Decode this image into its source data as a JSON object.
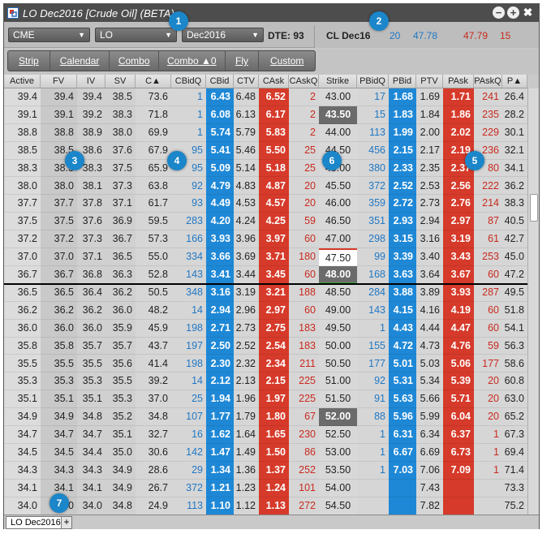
{
  "window": {
    "title": "LO Dec2016 [Crude Oil] (BETA)"
  },
  "toolbar": {
    "exchange": "CME",
    "product": "LO",
    "expiry": "Dec2016",
    "dte": "DTE: 93",
    "quote_contract": "CL Dec16",
    "quote_bidq": "20",
    "quote_bid": "47.78",
    "quote_ask": "47.79",
    "quote_askq": "15"
  },
  "buttons": [
    "Strip",
    "Calendar",
    "Combo",
    "Combo ▲0",
    "Fly",
    "Custom"
  ],
  "columns": [
    "Active",
    "FV",
    "IV",
    "SV",
    "C▲",
    "CBidQ",
    "CBid",
    "CTV",
    "CAsk",
    "CAskQ",
    "Strike",
    "PBidQ",
    "PBid",
    "PTV",
    "PAsk",
    "PAskQ",
    "P▲"
  ],
  "rows": [
    [
      "39.4",
      "39.4",
      "39.4",
      "38.5",
      "73.6",
      "1",
      "6.43",
      "6.48",
      "6.52",
      "2",
      "43.00",
      "17",
      "1.68",
      "1.69",
      "1.71",
      "241",
      "26.4"
    ],
    [
      "39.1",
      "39.1",
      "39.2",
      "38.3",
      "71.8",
      "1",
      "6.08",
      "6.13",
      "6.17",
      "2",
      "43.50",
      "15",
      "1.83",
      "1.84",
      "1.86",
      "235",
      "28.2"
    ],
    [
      "38.8",
      "38.8",
      "38.9",
      "38.0",
      "69.9",
      "1",
      "5.74",
      "5.79",
      "5.83",
      "2",
      "44.00",
      "113",
      "1.99",
      "2.00",
      "2.02",
      "229",
      "30.1"
    ],
    [
      "38.5",
      "38.5",
      "38.6",
      "37.6",
      "67.9",
      "95",
      "5.41",
      "5.46",
      "5.50",
      "25",
      "44.50",
      "456",
      "2.15",
      "2.17",
      "2.19",
      "236",
      "32.1"
    ],
    [
      "38.3",
      "38.3",
      "38.3",
      "37.5",
      "65.9",
      "95",
      "5.09",
      "5.14",
      "5.18",
      "25",
      "45.00",
      "380",
      "2.33",
      "2.35",
      "2.37",
      "80",
      "34.1"
    ],
    [
      "38.0",
      "38.0",
      "38.1",
      "37.3",
      "63.8",
      "92",
      "4.79",
      "4.83",
      "4.87",
      "20",
      "45.50",
      "372",
      "2.52",
      "2.53",
      "2.56",
      "222",
      "36.2"
    ],
    [
      "37.7",
      "37.7",
      "37.8",
      "37.1",
      "61.7",
      "93",
      "4.49",
      "4.53",
      "4.57",
      "20",
      "46.00",
      "359",
      "2.72",
      "2.73",
      "2.76",
      "214",
      "38.3"
    ],
    [
      "37.5",
      "37.5",
      "37.6",
      "36.9",
      "59.5",
      "283",
      "4.20",
      "4.24",
      "4.25",
      "59",
      "46.50",
      "351",
      "2.93",
      "2.94",
      "2.97",
      "87",
      "40.5"
    ],
    [
      "37.2",
      "37.2",
      "37.3",
      "36.7",
      "57.3",
      "166",
      "3.93",
      "3.96",
      "3.97",
      "60",
      "47.00",
      "298",
      "3.15",
      "3.16",
      "3.19",
      "61",
      "42.7"
    ],
    [
      "37.0",
      "37.0",
      "37.1",
      "36.5",
      "55.0",
      "334",
      "3.66",
      "3.69",
      "3.71",
      "180",
      "47.50",
      "99",
      "3.39",
      "3.40",
      "3.43",
      "253",
      "45.0"
    ],
    [
      "36.7",
      "36.7",
      "36.8",
      "36.3",
      "52.8",
      "143",
      "3.41",
      "3.44",
      "3.45",
      "60",
      "48.00",
      "168",
      "3.63",
      "3.64",
      "3.67",
      "60",
      "47.2"
    ],
    [
      "36.5",
      "36.5",
      "36.4",
      "36.2",
      "50.5",
      "348",
      "3.16",
      "3.19",
      "3.21",
      "188",
      "48.50",
      "284",
      "3.88",
      "3.89",
      "3.93",
      "287",
      "49.5"
    ],
    [
      "36.2",
      "36.2",
      "36.2",
      "36.0",
      "48.2",
      "14",
      "2.94",
      "2.96",
      "2.97",
      "60",
      "49.00",
      "143",
      "4.15",
      "4.16",
      "4.19",
      "60",
      "51.8"
    ],
    [
      "36.0",
      "36.0",
      "36.0",
      "35.9",
      "45.9",
      "198",
      "2.71",
      "2.73",
      "2.75",
      "183",
      "49.50",
      "1",
      "4.43",
      "4.44",
      "4.47",
      "60",
      "54.1"
    ],
    [
      "35.8",
      "35.8",
      "35.7",
      "35.7",
      "43.7",
      "197",
      "2.50",
      "2.52",
      "2.54",
      "183",
      "50.00",
      "155",
      "4.72",
      "4.73",
      "4.76",
      "59",
      "56.3"
    ],
    [
      "35.5",
      "35.5",
      "35.5",
      "35.6",
      "41.4",
      "198",
      "2.30",
      "2.32",
      "2.34",
      "211",
      "50.50",
      "177",
      "5.01",
      "5.03",
      "5.06",
      "177",
      "58.6"
    ],
    [
      "35.3",
      "35.3",
      "35.3",
      "35.5",
      "39.2",
      "14",
      "2.12",
      "2.13",
      "2.15",
      "225",
      "51.00",
      "92",
      "5.31",
      "5.34",
      "5.39",
      "20",
      "60.8"
    ],
    [
      "35.1",
      "35.1",
      "35.1",
      "35.3",
      "37.0",
      "25",
      "1.94",
      "1.96",
      "1.97",
      "225",
      "51.50",
      "91",
      "5.63",
      "5.66",
      "5.71",
      "20",
      "63.0"
    ],
    [
      "34.9",
      "34.9",
      "34.8",
      "35.2",
      "34.8",
      "107",
      "1.77",
      "1.79",
      "1.80",
      "67",
      "52.00",
      "88",
      "5.96",
      "5.99",
      "6.04",
      "20",
      "65.2"
    ],
    [
      "34.7",
      "34.7",
      "34.7",
      "35.1",
      "32.7",
      "16",
      "1.62",
      "1.64",
      "1.65",
      "230",
      "52.50",
      "1",
      "6.31",
      "6.34",
      "6.37",
      "1",
      "67.3"
    ],
    [
      "34.5",
      "34.5",
      "34.4",
      "35.0",
      "30.6",
      "142",
      "1.47",
      "1.49",
      "1.50",
      "86",
      "53.00",
      "1",
      "6.67",
      "6.69",
      "6.73",
      "1",
      "69.4"
    ],
    [
      "34.3",
      "34.3",
      "34.3",
      "34.9",
      "28.6",
      "29",
      "1.34",
      "1.36",
      "1.37",
      "252",
      "53.50",
      "1",
      "7.03",
      "7.06",
      "7.09",
      "1",
      "71.4"
    ],
    [
      "34.1",
      "34.1",
      "34.1",
      "34.9",
      "26.7",
      "372",
      "1.21",
      "1.23",
      "1.24",
      "101",
      "54.00",
      "",
      "",
      "7.43",
      "",
      "",
      "73.3"
    ],
    [
      "34.0",
      "34.0",
      "34.0",
      "34.8",
      "24.9",
      "113",
      "1.10",
      "1.12",
      "1.13",
      "272",
      "54.50",
      "",
      "",
      "7.82",
      "",
      "",
      "75.2"
    ]
  ],
  "highlight": {
    "atm_strike_row": 10,
    "current_strike_row": 9,
    "dark_strike_rows": [
      1,
      10,
      18
    ]
  },
  "tabs": {
    "active": "LO Dec2016",
    "add": "+"
  },
  "badges": [
    "1",
    "2",
    "3",
    "4",
    "5",
    "6",
    "7"
  ],
  "colors": {
    "bid_blue": "#1e88d6",
    "ask_red": "#d63a2a",
    "qty_blue": "#2178c4",
    "qty_red": "#c82a1f"
  }
}
